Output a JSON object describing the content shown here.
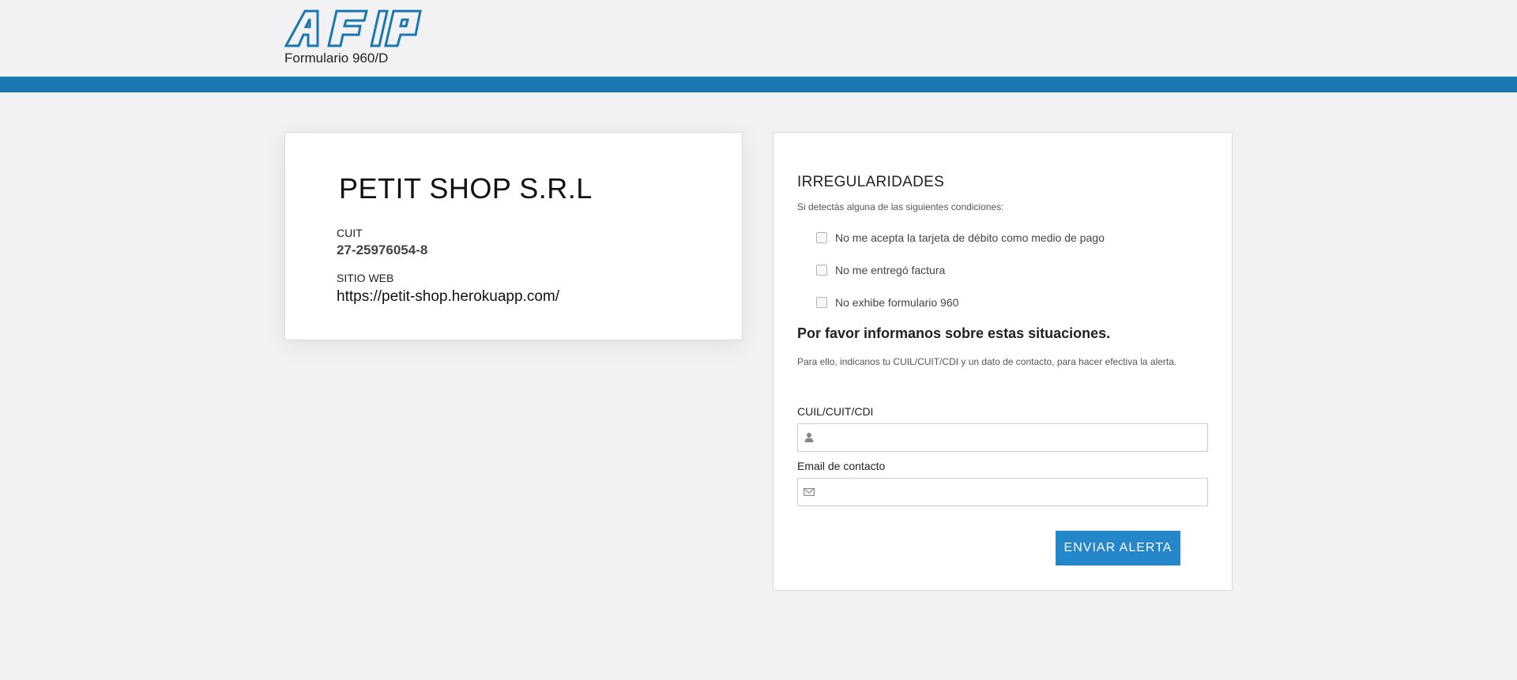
{
  "header": {
    "logo_text": "AFIP",
    "form_subtitle": "Formulario 960/D",
    "band_color": "#1b77b0"
  },
  "shop": {
    "name": "PETIT SHOP S.R.L",
    "cuit_label": "CUIT",
    "cuit_value": "27-25976054-8",
    "web_label": "SITIO WEB",
    "web_value": "https://petit-shop.herokuapp.com/"
  },
  "irregularities": {
    "title": "IRREGULARIDADES",
    "subtitle": "Si detectás alguna de las siguientes condiciones:",
    "options": [
      {
        "label": "No me acepta la tarjeta de débito como medio de pago",
        "checked": false
      },
      {
        "label": "No me entregó factura",
        "checked": false
      },
      {
        "label": "No exhibe formulario 960",
        "checked": false
      }
    ]
  },
  "alert": {
    "heading": "Por favor informanos sobre estas situaciones.",
    "text": "Para ello, indicanos tu CUIL/CUIT/CDI y un dato de contacto, para hacer efectiva la alerta.",
    "cuil_label": "CUIL/CUIT/CDI",
    "cuil_value": "",
    "cuil_icon": "user-icon",
    "email_label": "Email de contacto",
    "email_value": "",
    "email_icon": "envelope-icon",
    "submit_label": "ENVIAR ALERTA",
    "accent_color": "#2487c9"
  }
}
